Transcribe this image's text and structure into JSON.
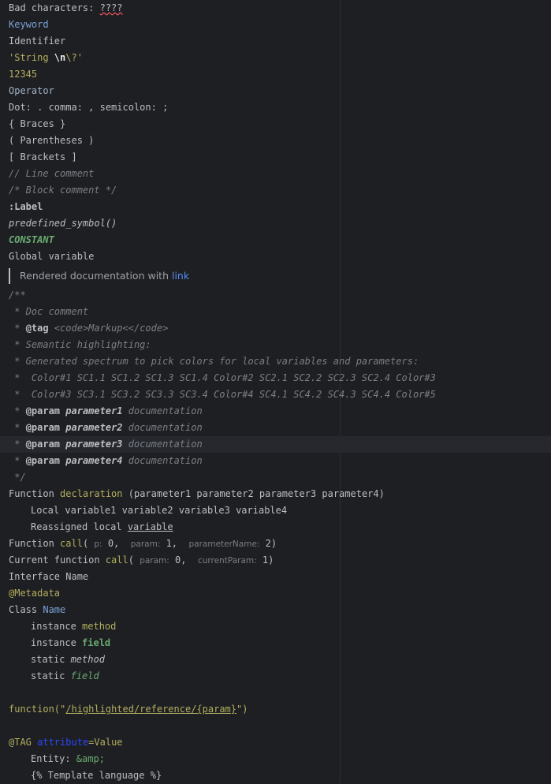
{
  "lines": {
    "bad_label": "Bad characters: ",
    "bad_chars": "????",
    "keyword": "Keyword",
    "identifier": "Identifier",
    "string_a": "'String ",
    "string_esc": "\\n",
    "string_b": "\\?'",
    "number": "12345",
    "operator": "Operator",
    "dot_line": "Dot: . comma: , semicolon: ;",
    "braces_open": "{ ",
    "braces_word": "Braces",
    "braces_close": " }",
    "paren_open": "( ",
    "paren_word": "Parentheses",
    "paren_close": " )",
    "bracket_open": "[ ",
    "bracket_word": "Brackets",
    "bracket_close": " ]",
    "line_comment": "// Line comment",
    "block_comment": "/* Block comment */",
    "label": ":Label",
    "predefined": "predefined_symbol()",
    "constant": "CONSTANT",
    "global_var": "Global variable"
  },
  "rendered_doc": {
    "text": "Rendered documentation with ",
    "link": "link"
  },
  "doc_comment": {
    "open": "/**",
    "l1": " * Doc comment",
    "l2_star": " * ",
    "l2_tag": "@tag",
    "l2_rest": " <code>Markup<</code>",
    "l3": " * Semantic highlighting:",
    "l4": " * Generated spectrum to pick colors for local variables and parameters:",
    "l5": " *  Color#1 SC1.1 SC1.2 SC1.3 SC1.4 Color#2 SC2.1 SC2.2 SC2.3 SC2.4 Color#3",
    "l6": " *  Color#3 SC3.1 SC3.2 SC3.3 SC3.4 Color#4 SC4.1 SC4.2 SC4.3 SC4.4 Color#5",
    "params": [
      {
        "star": " * ",
        "tag": "@param",
        "name": "parameter1",
        "desc": "documentation"
      },
      {
        "star": " * ",
        "tag": "@param",
        "name": "parameter2",
        "desc": "documentation"
      },
      {
        "star": " * ",
        "tag": "@param",
        "name": "parameter3",
        "desc": "documentation"
      },
      {
        "star": " * ",
        "tag": "@param",
        "name": "parameter4",
        "desc": "documentation"
      }
    ],
    "close": " */"
  },
  "code": {
    "func_kw": "Function ",
    "func_decl": "declaration",
    "func_params": " (parameter1 parameter2 parameter3 parameter4)",
    "local_vars": "Local variable1 variable2 variable3 variable4",
    "reassigned_a": "Reassigned local ",
    "reassigned_b": "variable",
    "call_kw": "Function ",
    "call_name": "call",
    "call_open": "( ",
    "hint_p": "p:",
    "arg0": " 0, ",
    "hint_param": "param:",
    "arg1": " 1, ",
    "hint_paramName": "parameterName:",
    "arg2": " 2)",
    "current_kw": "Current function ",
    "current_name": "call",
    "current_open": "( ",
    "hint_param2": "param:",
    "carg0": " 0, ",
    "hint_currentParam": "currentParam:",
    "carg1": " 1)",
    "interface_line": "Interface Name",
    "metadata": "@Metadata",
    "class_kw": "Class ",
    "class_name": "Name",
    "inst_method_a": "instance ",
    "inst_method_b": "method",
    "inst_field_a": "instance ",
    "inst_field_b": "field",
    "static_method_a": "static ",
    "static_method_b": "method",
    "static_field_a": "static ",
    "static_field_b": "field",
    "ref_func": "function(",
    "ref_q1": "\"",
    "ref_path": "/highlighted/reference/",
    "ref_param": "{param}",
    "ref_q2": "\")",
    "tag_at": "@TAG ",
    "tag_attr": "attribute",
    "tag_eq": "=",
    "tag_val": "Value",
    "entity_a": "Entity: ",
    "entity_b": "&amp;",
    "template": "{% Template language %}"
  }
}
